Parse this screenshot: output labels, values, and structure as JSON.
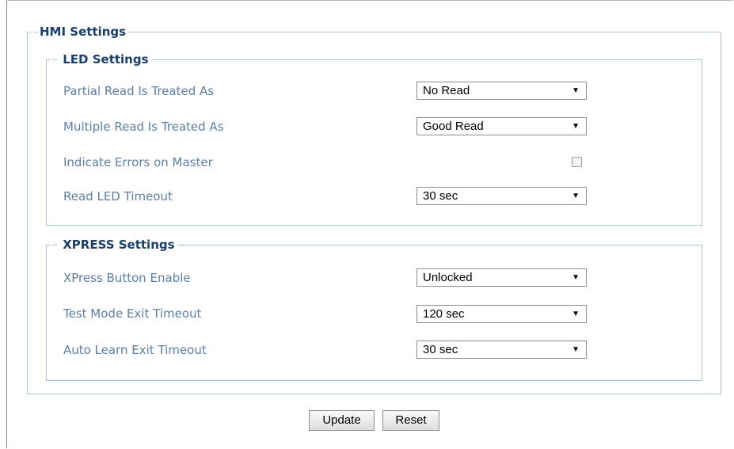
{
  "hmi": {
    "legend": "HMI Settings",
    "led": {
      "legend": "LED Settings",
      "partial_read": {
        "label": "Partial Read Is Treated As",
        "value": "No Read"
      },
      "multiple_read": {
        "label": "Multiple Read Is Treated As",
        "value": "Good Read"
      },
      "indicate_errors": {
        "label": "Indicate Errors on Master",
        "checked": false
      },
      "read_led_timeout": {
        "label": "Read LED Timeout",
        "value": "30 sec"
      }
    },
    "xpress": {
      "legend": "XPRESS Settings",
      "button_enable": {
        "label": "XPress Button Enable",
        "value": "Unlocked"
      },
      "test_mode_exit": {
        "label": "Test Mode Exit Timeout",
        "value": "120 sec"
      },
      "auto_learn_exit": {
        "label": "Auto Learn Exit Timeout",
        "value": "30 sec"
      }
    }
  },
  "buttons": {
    "update": "Update",
    "reset": "Reset"
  },
  "icons": {
    "dropdown": "triangle-down-icon"
  },
  "colors": {
    "label": "#5b7fa6",
    "legend": "#1a3f6b",
    "border": "#a9c3dd"
  }
}
